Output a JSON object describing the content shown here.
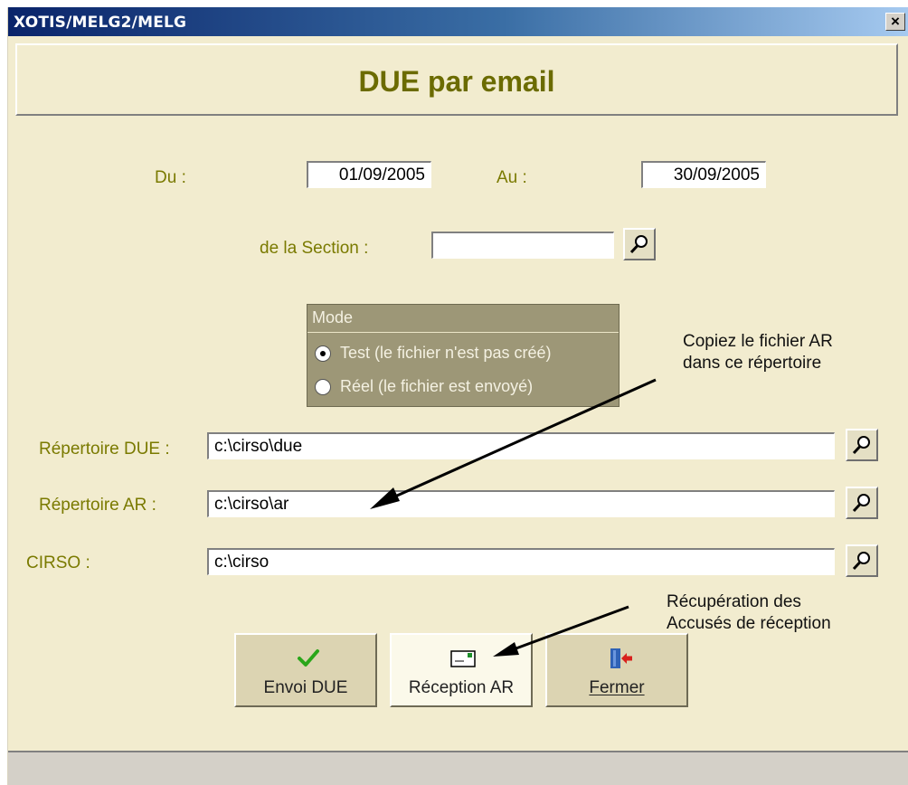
{
  "window": {
    "title": "XOTIS/MELG2/MELG",
    "close_label": "×"
  },
  "header": {
    "title": "DUE par email"
  },
  "dates": {
    "du_label": "Du :",
    "du_value": "01/09/2005",
    "au_label": "Au :",
    "au_value": "30/09/2005"
  },
  "section": {
    "label": "de la Section :",
    "value": ""
  },
  "mode": {
    "title": "Mode",
    "options": [
      {
        "label": "Test (le fichier n'est pas créé)",
        "selected": true
      },
      {
        "label": "Réel (le fichier est envoyé)",
        "selected": false
      }
    ]
  },
  "paths": {
    "due_label": "Répertoire DUE :",
    "due_value": "c:\\cirso\\due",
    "ar_label": "Répertoire AR :",
    "ar_value": "c:\\cirso\\ar",
    "cirso_label": "CIRSO :",
    "cirso_value": "c:\\cirso"
  },
  "buttons": {
    "envoi": "Envoi DUE",
    "reception": "Réception AR",
    "fermer": "Fermer"
  },
  "annotations": {
    "copy_line1": "Copiez le fichier AR",
    "copy_line2": "dans ce répertoire",
    "recup_line1": "Récupération des",
    "recup_line2": "Accusés de réception"
  },
  "icons": {
    "search": "magnifier-icon",
    "check": "check-icon",
    "mail": "envelope-icon",
    "exit": "door-exit-icon"
  },
  "colors": {
    "title_gradient_start": "#0a246a",
    "form_bg": "#f2eccf",
    "label_olive": "#7a7a00",
    "header_text": "#6b6b00",
    "mode_bg": "#9d9777"
  }
}
